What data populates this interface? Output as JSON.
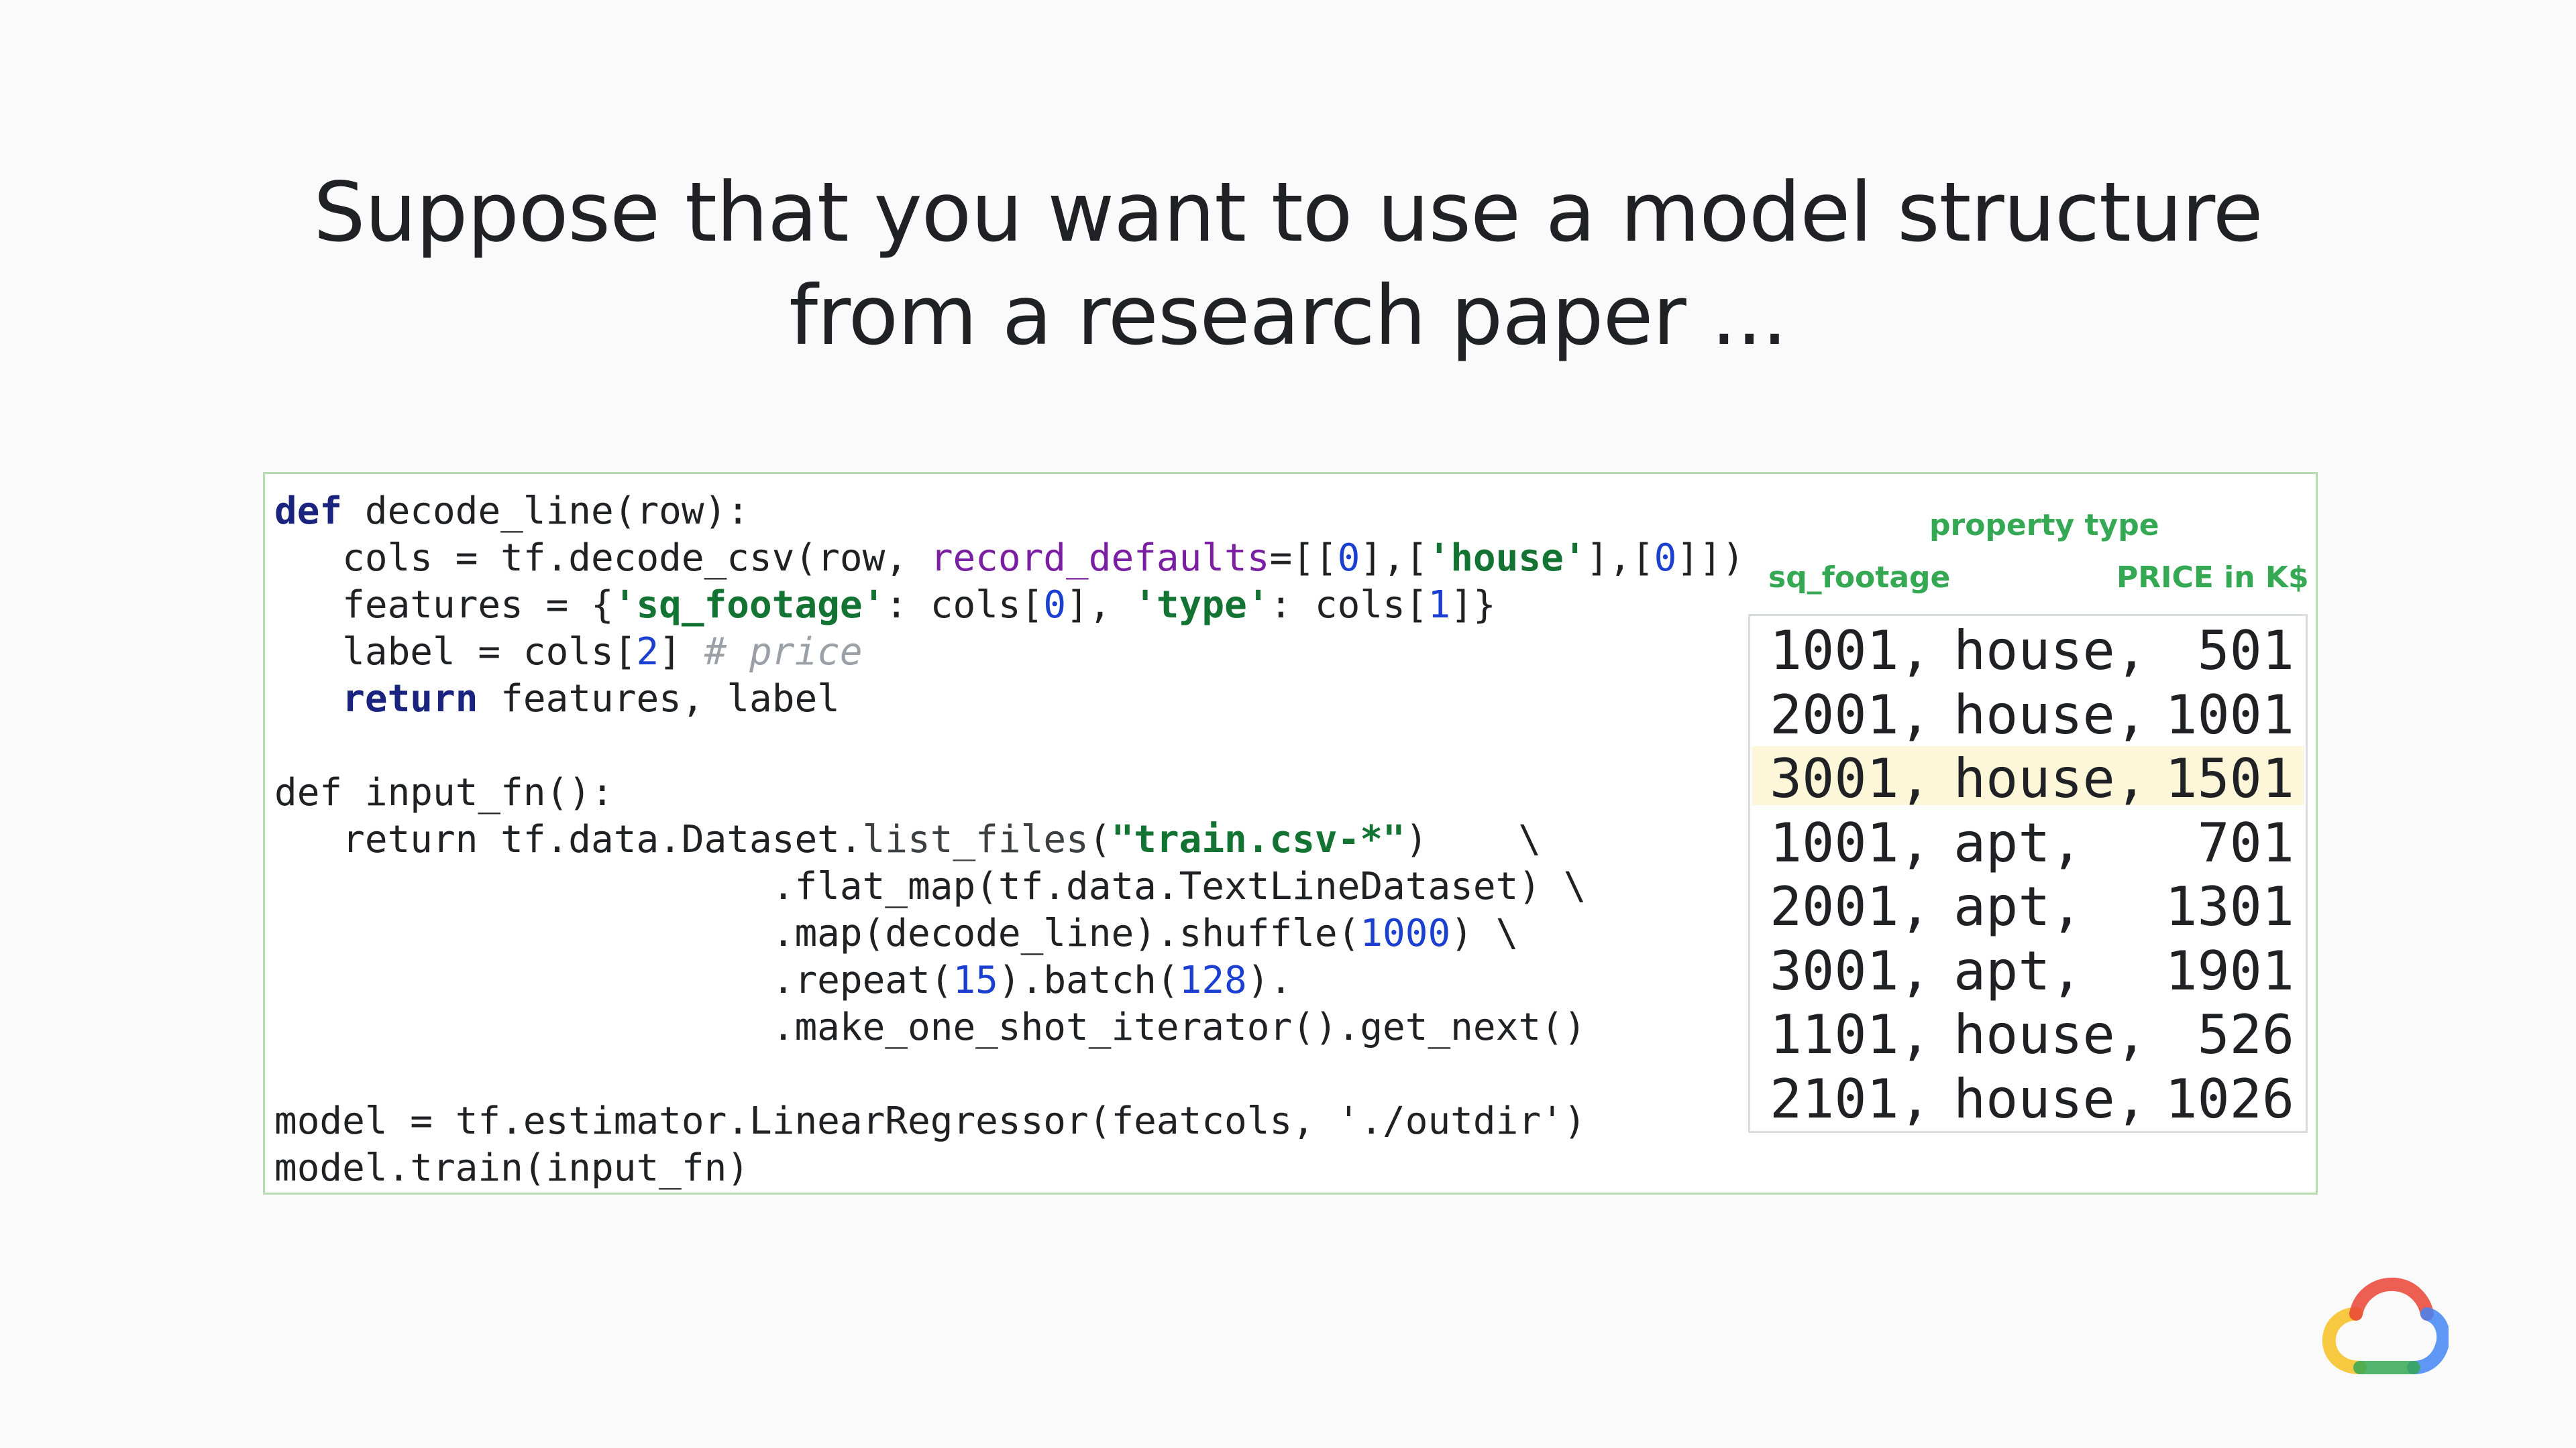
{
  "slide": {
    "title_line1": "Suppose that you want to use a model structure",
    "title_line2": "from a research paper ..."
  },
  "code_lines": [
    [
      {
        "t": "def",
        "c": "kw"
      },
      {
        "t": " decode_line(row):",
        "c": ""
      }
    ],
    [
      {
        "t": "   cols = tf.decode_csv(row, ",
        "c": ""
      },
      {
        "t": "record_defaults",
        "c": "param"
      },
      {
        "t": "=[[",
        "c": ""
      },
      {
        "t": "0",
        "c": "num"
      },
      {
        "t": "],[",
        "c": ""
      },
      {
        "t": "'house'",
        "c": "str"
      },
      {
        "t": "],[",
        "c": ""
      },
      {
        "t": "0",
        "c": "num"
      },
      {
        "t": "]])",
        "c": ""
      }
    ],
    [
      {
        "t": "   features = {",
        "c": ""
      },
      {
        "t": "'sq_footage'",
        "c": "str"
      },
      {
        "t": ": cols[",
        "c": ""
      },
      {
        "t": "0",
        "c": "num"
      },
      {
        "t": "], ",
        "c": ""
      },
      {
        "t": "'type'",
        "c": "str"
      },
      {
        "t": ": cols[",
        "c": ""
      },
      {
        "t": "1",
        "c": "num"
      },
      {
        "t": "]}",
        "c": ""
      }
    ],
    [
      {
        "t": "   label = cols[",
        "c": ""
      },
      {
        "t": "2",
        "c": "num"
      },
      {
        "t": "] ",
        "c": ""
      },
      {
        "t": "# price",
        "c": "cm"
      }
    ],
    [
      {
        "t": "   ",
        "c": ""
      },
      {
        "t": "return",
        "c": "kw"
      },
      {
        "t": " features, label",
        "c": ""
      }
    ],
    [
      {
        "t": "",
        "c": ""
      }
    ],
    [
      {
        "t": "def input_fn():",
        "c": ""
      }
    ],
    [
      {
        "t": "   return",
        "c": "kw2"
      },
      {
        "t": " tf.data.Dataset.",
        "c": ""
      },
      {
        "t": "list_files",
        "c": "fn"
      },
      {
        "t": "(",
        "c": ""
      },
      {
        "t": "\"train.csv-*\"",
        "c": "str"
      },
      {
        "t": ")    \\",
        "c": ""
      }
    ],
    [
      {
        "t": "                      .flat_map(tf.data.TextLineDataset) \\",
        "c": ""
      }
    ],
    [
      {
        "t": "                      .map(decode_line).shuffle(",
        "c": ""
      },
      {
        "t": "1000",
        "c": "num"
      },
      {
        "t": ") \\",
        "c": ""
      }
    ],
    [
      {
        "t": "                      .repeat(",
        "c": ""
      },
      {
        "t": "15",
        "c": "num"
      },
      {
        "t": ").batch(",
        "c": ""
      },
      {
        "t": "128",
        "c": "num"
      },
      {
        "t": ").",
        "c": ""
      }
    ],
    [
      {
        "t": "                      .make_one_shot_iterator().get_next()",
        "c": ""
      }
    ],
    [
      {
        "t": "",
        "c": ""
      }
    ],
    [
      {
        "t": "model = tf.estimator.LinearRegressor(featcols, './outdir')",
        "c": ""
      }
    ],
    [
      {
        "t": "model.train(input_fn)",
        "c": ""
      }
    ]
  ],
  "data_table": {
    "label_property_type": "property type",
    "label_sq_footage": "sq_footage",
    "label_price": "PRICE in K$",
    "rows": [
      {
        "sq": "1001,",
        "type": "house,",
        "price": "501",
        "highlight": false
      },
      {
        "sq": "2001,",
        "type": "house,",
        "price": "1001",
        "highlight": false
      },
      {
        "sq": "3001,",
        "type": "house,",
        "price": "1501",
        "highlight": true
      },
      {
        "sq": "1001,",
        "type": "apt,",
        "price": "701",
        "highlight": false
      },
      {
        "sq": "2001,",
        "type": "apt,",
        "price": "1301",
        "highlight": false
      },
      {
        "sq": "3001,",
        "type": "apt,",
        "price": "1901",
        "highlight": false
      },
      {
        "sq": "1101,",
        "type": "house,",
        "price": "526",
        "highlight": false
      },
      {
        "sq": "2101,",
        "type": "house,",
        "price": "1026",
        "highlight": false
      }
    ]
  },
  "logo": {
    "icon": "google-cloud-logo-icon"
  }
}
